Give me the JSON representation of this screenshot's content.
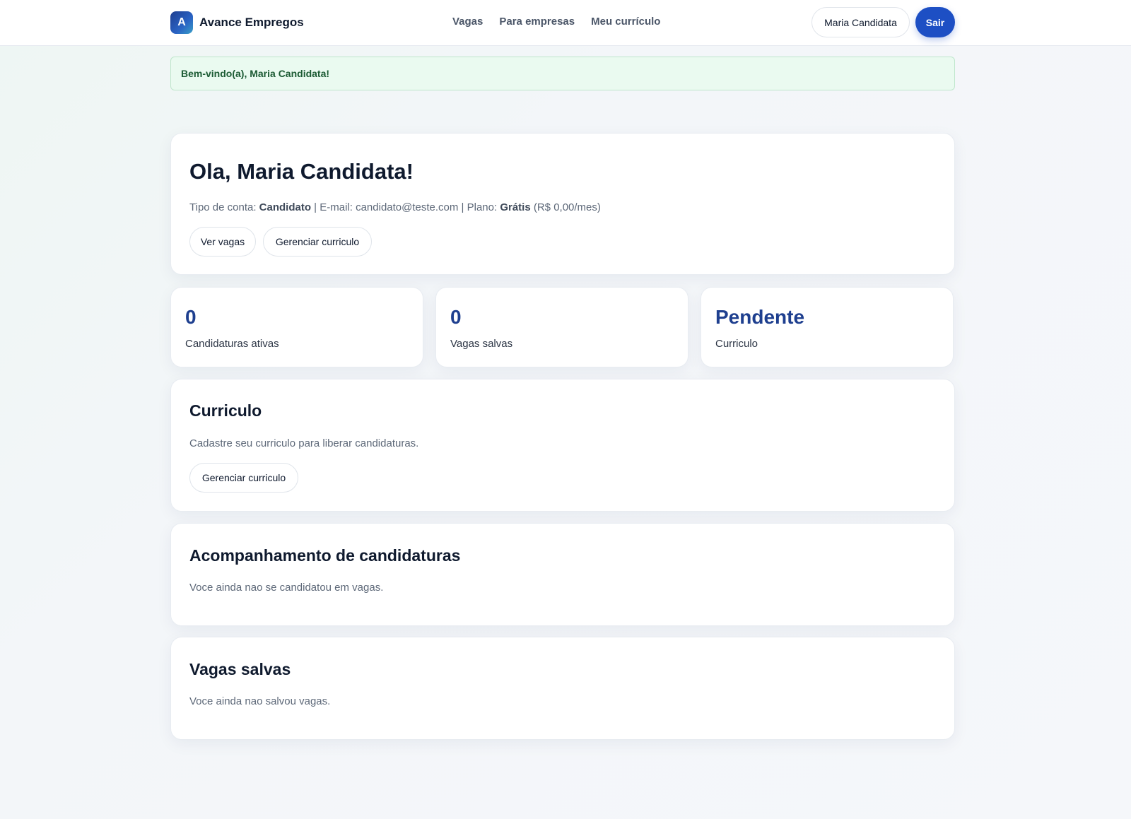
{
  "header": {
    "logo_letter": "A",
    "brand": "Avance Empregos",
    "nav": [
      "Vagas",
      "Para empresas",
      "Meu currículo"
    ],
    "user_name": "Maria Candidata",
    "logout_label": "Sair"
  },
  "flash": {
    "message": "Bem-vindo(a), Maria Candidata!"
  },
  "welcome": {
    "title": "Ola, Maria Candidata!",
    "account_type_label": "Tipo de conta: ",
    "account_type": "Candidato",
    "email_label": " | E-mail: candidato@teste.com | Plano: ",
    "plan": "Grátis",
    "price": " (R$ 0,00/mes)",
    "btn_jobs": "Ver vagas",
    "btn_resume": "Gerenciar curriculo"
  },
  "stats": [
    {
      "value": "0",
      "label": "Candidaturas ativas"
    },
    {
      "value": "0",
      "label": "Vagas salvas"
    },
    {
      "value": "Pendente",
      "label": "Curriculo"
    }
  ],
  "resume": {
    "title": "Curriculo",
    "text": "Cadastre seu curriculo para liberar candidaturas.",
    "button": "Gerenciar curriculo"
  },
  "applications": {
    "title": "Acompanhamento de candidaturas",
    "text": "Voce ainda nao se candidatou em vagas."
  },
  "saved": {
    "title": "Vagas salvas",
    "text": "Voce ainda nao salvou vagas."
  },
  "colors": {
    "primary": "#1d4fc4",
    "stat_value": "#1e3f8f",
    "flash_bg": "#eafaf0",
    "flash_text": "#1c5b34"
  }
}
